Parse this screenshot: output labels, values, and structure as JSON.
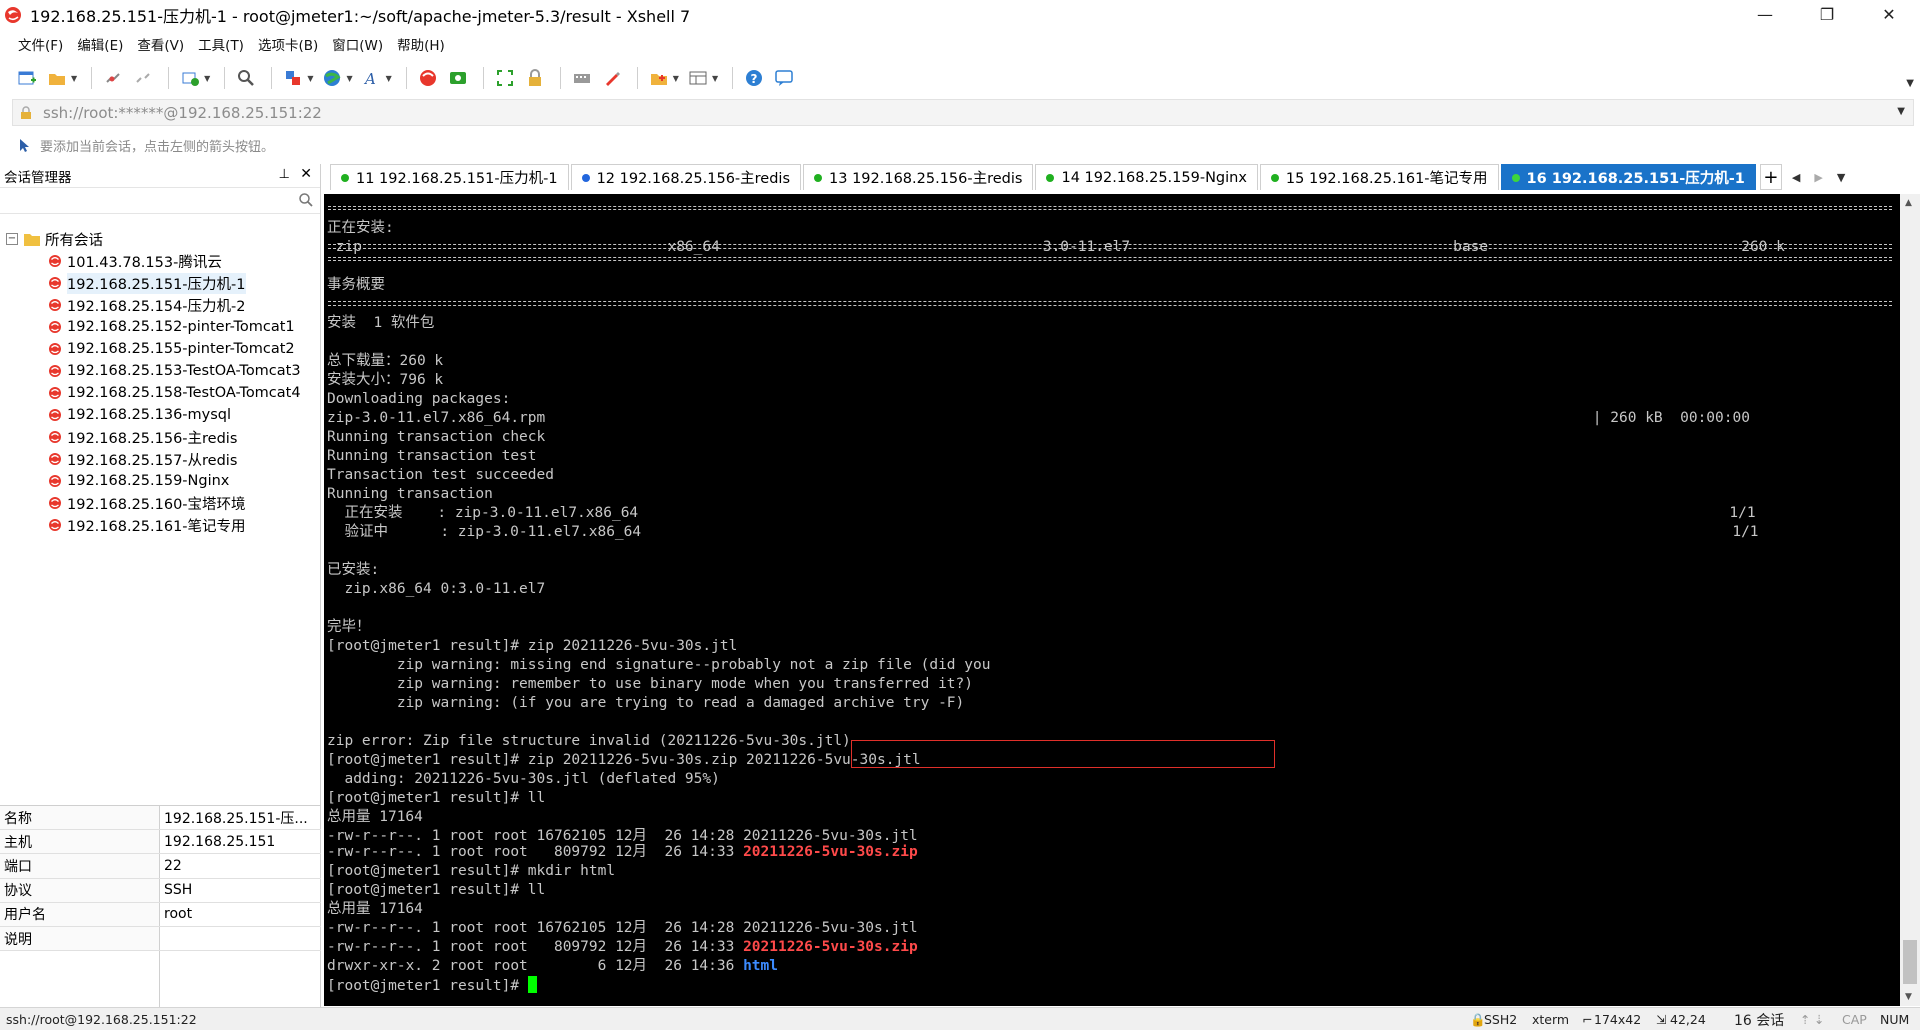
{
  "window": {
    "title": "192.168.25.151-压力机-1 - root@jmeter1:~/soft/apache-jmeter-5.3/result - Xshell 7",
    "minimize": "—",
    "restore": "❐",
    "close": "✕"
  },
  "menu": [
    "文件(F)",
    "编辑(E)",
    "查看(V)",
    "工具(T)",
    "选项卡(B)",
    "窗口(W)",
    "帮助(H)"
  ],
  "address": {
    "value": "ssh://root:******@192.168.25.151:22"
  },
  "hint": "要添加当前会话，点击左侧的箭头按钮。",
  "session_manager": {
    "title": "会话管理器",
    "pin": "📌",
    "close": "✕",
    "root_label": "所有会话",
    "expand_symbol": "−",
    "items": [
      "101.43.78.153-腾讯云",
      "192.168.25.151-压力机-1",
      "192.168.25.154-压力机-2",
      "192.168.25.152-pinter-Tomcat1",
      "192.168.25.155-pinter-Tomcat2",
      "192.168.25.153-TestOA-Tomcat3",
      "192.168.25.158-TestOA-Tomcat4",
      "192.168.25.136-mysql",
      "192.168.25.156-主redis",
      "192.168.25.157-从redis",
      "192.168.25.159-Nginx",
      "192.168.25.160-宝塔环境",
      "192.168.25.161-笔记专用"
    ],
    "selected_index": 1
  },
  "properties": [
    {
      "key": "名称",
      "value": "192.168.25.151-压..."
    },
    {
      "key": "主机",
      "value": "192.168.25.151"
    },
    {
      "key": "端口",
      "value": "22"
    },
    {
      "key": "协议",
      "value": "SSH"
    },
    {
      "key": "用户名",
      "value": "root"
    },
    {
      "key": "说明",
      "value": ""
    }
  ],
  "tabs": [
    {
      "label": "11 192.168.25.151-压力机-1",
      "active": false
    },
    {
      "label": "12 192.168.25.156-主redis",
      "active": false
    },
    {
      "label": "13 192.168.25.156-主redis",
      "active": false
    },
    {
      "label": "14 192.168.25.159-Nginx",
      "active": false
    },
    {
      "label": "15 192.168.25.161-笔记专用",
      "active": false
    },
    {
      "label": "16 192.168.25.151-压力机-1",
      "active": true
    }
  ],
  "tab_add": "+",
  "terminal": {
    "lines": [
      "正在安装:",
      " zip                                   x86_64                                     3.0-11.el7                                     base                             260 k",
      "",
      "事务概要",
      "",
      "安装  1 软件包",
      "",
      "总下载量：260 k",
      "安装大小：796 k",
      "Downloading packages:",
      "zip-3.0-11.el7.x86_64.rpm                                                                                                                        | 260 kB  00:00:00",
      "Running transaction check",
      "Running transaction test",
      "Transaction test succeeded",
      "Running transaction",
      "  正在安装    : zip-3.0-11.el7.x86_64                                                                                                                             1/1",
      "  验证中      : zip-3.0-11.el7.x86_64                                                                                                                             1/1",
      "",
      "已安装:",
      "  zip.x86_64 0:3.0-11.el7",
      "",
      "完毕！",
      "[root@jmeter1 result]# zip 20211226-5vu-30s.jtl",
      "        zip warning: missing end signature--probably not a zip file (did you",
      "        zip warning: remember to use binary mode when you transferred it?)",
      "        zip warning: (if you are trying to read a damaged archive try -F)",
      "",
      "zip error: Zip file structure invalid (20211226-5vu-30s.jtl)",
      "[root@jmeter1 result]# zip 20211226-5vu-30s.zip 20211226-5vu-30s.jtl",
      "  adding: 20211226-5vu-30s.jtl (deflated 95%)",
      "[root@jmeter1 result]# ll",
      "总用量 17164",
      "-rw-r--r--. 1 root root 16762105 12月  26 14:28 20211226-5vu-30s.jtl"
    ],
    "ll1_zip_prefix": "-rw-r--r--. 1 root root   809792 12月  26 14:33 ",
    "zip_name": "20211226-5vu-30s.zip",
    "cmd_mkdir": "[root@jmeter1 result]# mkdir html",
    "cmd_ll2": "[root@jmeter1 result]# ll",
    "total2": "总用量 17164",
    "ll2_jtl": "-rw-r--r--. 1 root root 16762105 12月  26 14:28 20211226-5vu-30s.jtl",
    "ll2_zip_prefix": "-rw-r--r--. 1 root root   809792 12月  26 14:33 ",
    "ll2_dir_prefix": "drwxr-xr-x. 2 root root        6 12月  26 14:36 ",
    "dir_name": "html",
    "prompt": "[root@jmeter1 result]# "
  },
  "statusbar": {
    "left": "ssh://root@192.168.25.151:22",
    "protocol": "SSH2",
    "term": "xterm",
    "size": "174x42",
    "pos": "42,24",
    "sessions": "16 会话",
    "cap": "CAP",
    "num": "NUM"
  },
  "colors": {
    "active_tab": "#1a73c9",
    "terminal_bg": "#000000",
    "zip_file": "#ff4a4a",
    "directory": "#3c8bff",
    "cursor": "#00ff00",
    "highlight": "#e0302a"
  }
}
